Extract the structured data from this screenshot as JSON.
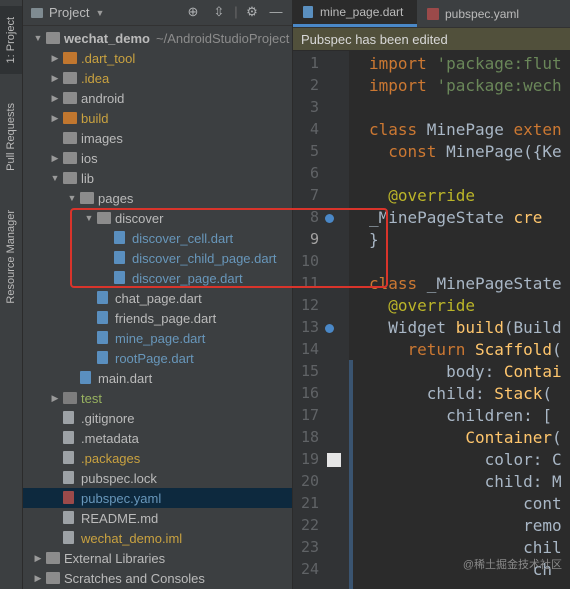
{
  "left_strip": {
    "tabs": [
      {
        "label": "1: Project",
        "icon": "project-icon"
      },
      {
        "label": "Pull Requests",
        "icon": "pull-requests-icon"
      },
      {
        "label": "Resource Manager",
        "icon": "resource-manager-icon"
      }
    ]
  },
  "project_panel": {
    "title": "Project",
    "tree": [
      {
        "label": "wechat_demo",
        "suffix": "~/AndroidStudioProject",
        "kind": "module",
        "depth": 0,
        "open": true
      },
      {
        "label": ".dart_tool",
        "kind": "folder-orange",
        "depth": 1,
        "open": false,
        "color": "#c9a240"
      },
      {
        "label": ".idea",
        "kind": "folder",
        "depth": 1,
        "open": false,
        "color": "#c9a240"
      },
      {
        "label": "android",
        "kind": "folder",
        "depth": 1,
        "open": false,
        "color": "#bbbbbb"
      },
      {
        "label": "build",
        "kind": "folder-orange",
        "depth": 1,
        "open": false,
        "color": "#c9a240"
      },
      {
        "label": "images",
        "kind": "folder",
        "depth": 1,
        "open": null,
        "color": "#bbbbbb"
      },
      {
        "label": "ios",
        "kind": "folder",
        "depth": 1,
        "open": false,
        "color": "#bbbbbb"
      },
      {
        "label": "lib",
        "kind": "folder",
        "depth": 1,
        "open": true,
        "color": "#bbbbbb"
      },
      {
        "label": "pages",
        "kind": "folder",
        "depth": 2,
        "open": true,
        "color": "#bbbbbb"
      },
      {
        "label": "discover",
        "kind": "folder",
        "depth": 3,
        "open": true,
        "color": "#bbbbbb"
      },
      {
        "label": "discover_cell.dart",
        "kind": "dart",
        "depth": 4,
        "color": "#6897bb"
      },
      {
        "label": "discover_child_page.dart",
        "kind": "dart",
        "depth": 4,
        "color": "#6897bb"
      },
      {
        "label": "discover_page.dart",
        "kind": "dart",
        "depth": 4,
        "color": "#6897bb"
      },
      {
        "label": "chat_page.dart",
        "kind": "dart",
        "depth": 3,
        "color": "#bbbbbb"
      },
      {
        "label": "friends_page.dart",
        "kind": "dart",
        "depth": 3,
        "color": "#bbbbbb"
      },
      {
        "label": "mine_page.dart",
        "kind": "dart",
        "depth": 3,
        "color": "#6897bb"
      },
      {
        "label": "rootPage.dart",
        "kind": "dart",
        "depth": 3,
        "color": "#6897bb"
      },
      {
        "label": "main.dart",
        "kind": "dart",
        "depth": 2,
        "color": "#bbbbbb"
      },
      {
        "label": "test",
        "kind": "folder-grey",
        "depth": 1,
        "open": false,
        "color": "#98b260"
      },
      {
        "label": ".gitignore",
        "kind": "file",
        "depth": 1,
        "color": "#bbbbbb"
      },
      {
        "label": ".metadata",
        "kind": "file",
        "depth": 1,
        "color": "#bbbbbb"
      },
      {
        "label": ".packages",
        "kind": "file",
        "depth": 1,
        "color": "#c9a240"
      },
      {
        "label": "pubspec.lock",
        "kind": "file",
        "depth": 1,
        "color": "#bbbbbb"
      },
      {
        "label": "pubspec.yaml",
        "kind": "yaml",
        "depth": 1,
        "color": "#6897bb",
        "selected": true
      },
      {
        "label": "README.md",
        "kind": "file",
        "depth": 1,
        "color": "#bbbbbb"
      },
      {
        "label": "wechat_demo.iml",
        "kind": "file",
        "depth": 1,
        "color": "#c9a240"
      },
      {
        "label": "External Libraries",
        "kind": "libs",
        "depth": 0,
        "open": false,
        "color": "#bbbbbb"
      },
      {
        "label": "Scratches and Consoles",
        "kind": "scratch",
        "depth": 0,
        "open": false,
        "color": "#bbbbbb"
      }
    ]
  },
  "editor": {
    "tabs": [
      {
        "label": "mine_page.dart",
        "active": true,
        "icon": "dart-file-icon"
      },
      {
        "label": "pubspec.yaml",
        "active": false,
        "icon": "yaml-file-icon"
      }
    ],
    "notice": "Pubspec has been edited",
    "lines": [
      {
        "n": "1",
        "html": "<span class='k'>import</span> <span class='s'>'package:flut</span>"
      },
      {
        "n": "2",
        "html": "<span class='k'>import</span> <span class='s'>'package:wech</span>"
      },
      {
        "n": "3",
        "html": ""
      },
      {
        "n": "4",
        "html": "<span class='k'>class</span> MinePage <span class='k'>exten</span>"
      },
      {
        "n": "5",
        "html": "  <span class='k'>const</span> MinePage({Ke</span>"
      },
      {
        "n": "6",
        "html": ""
      },
      {
        "n": "7",
        "html": "  <span class='a'>@override</span>"
      },
      {
        "n": "8",
        "html": "_MinePageState <span class='f'>cre</span>"
      },
      {
        "n": "9",
        "html": "}"
      },
      {
        "n": "10",
        "html": ""
      },
      {
        "n": "11",
        "html": "<span class='k'>class</span> _MinePageState"
      },
      {
        "n": "12",
        "html": "  <span class='a'>@override</span>"
      },
      {
        "n": "13",
        "html": "  Widget <span class='f'>build</span>(Build"
      },
      {
        "n": "14",
        "html": "    <span class='k'>return</span> <span class='f'>Scaffold</span>("
      },
      {
        "n": "15",
        "html": "        body: <span class='f'>Contai</span>"
      },
      {
        "n": "16",
        "html": "      child: <span class='f'>Stack</span>("
      },
      {
        "n": "17",
        "html": "        children: ["
      },
      {
        "n": "18",
        "html": "          <span class='f'>Container</span>("
      },
      {
        "n": "19",
        "html": "            color: C"
      },
      {
        "n": "20",
        "html": "            child: M"
      },
      {
        "n": "21",
        "html": "                cont"
      },
      {
        "n": "22",
        "html": "                remo"
      },
      {
        "n": "23",
        "html": "                chil"
      },
      {
        "n": "24",
        "html": "                 ch"
      }
    ],
    "current_line": "9"
  },
  "watermark": "@稀土掘金技术社区"
}
